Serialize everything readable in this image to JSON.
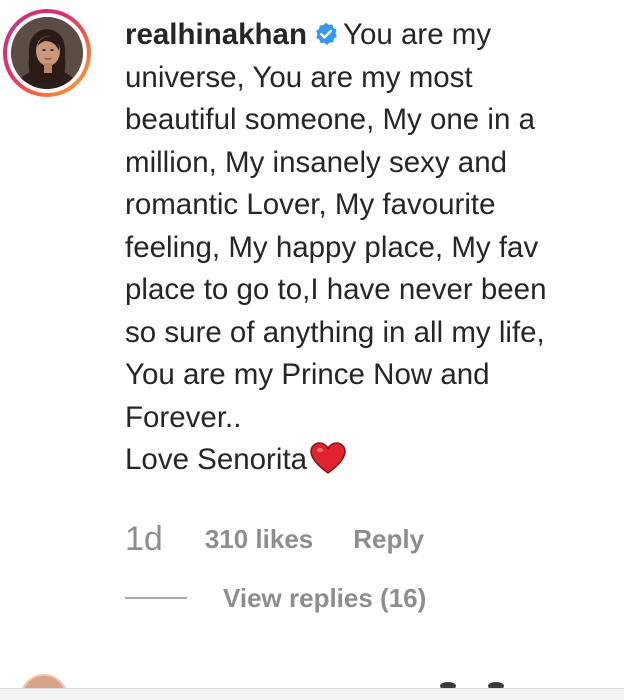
{
  "comment": {
    "username": "realhinakhan",
    "verified_icon": "verified-badge-icon",
    "lines": [
      "You are my",
      "universe, You are my most",
      "beautiful someone, My one in a",
      "million, My insanely sexy and",
      "romantic Lover, My favourite",
      "feeling, My happy place, My fav",
      "place to go to,I have never been",
      "so sure of anything in all my life,",
      "You are my Prince Now and",
      "Forever..",
      "Love Senorita"
    ],
    "emoji": "heart-icon",
    "time": "1d",
    "likes": "310 likes",
    "reply_label": "Reply",
    "view_replies_label": "View replies (16)"
  },
  "colors": {
    "verified": "#3897f0",
    "heart": "#e0242f",
    "meta_text": "#8e8e8e",
    "story_ring_start": "#c13584",
    "story_ring_end": "#fcaf45"
  }
}
